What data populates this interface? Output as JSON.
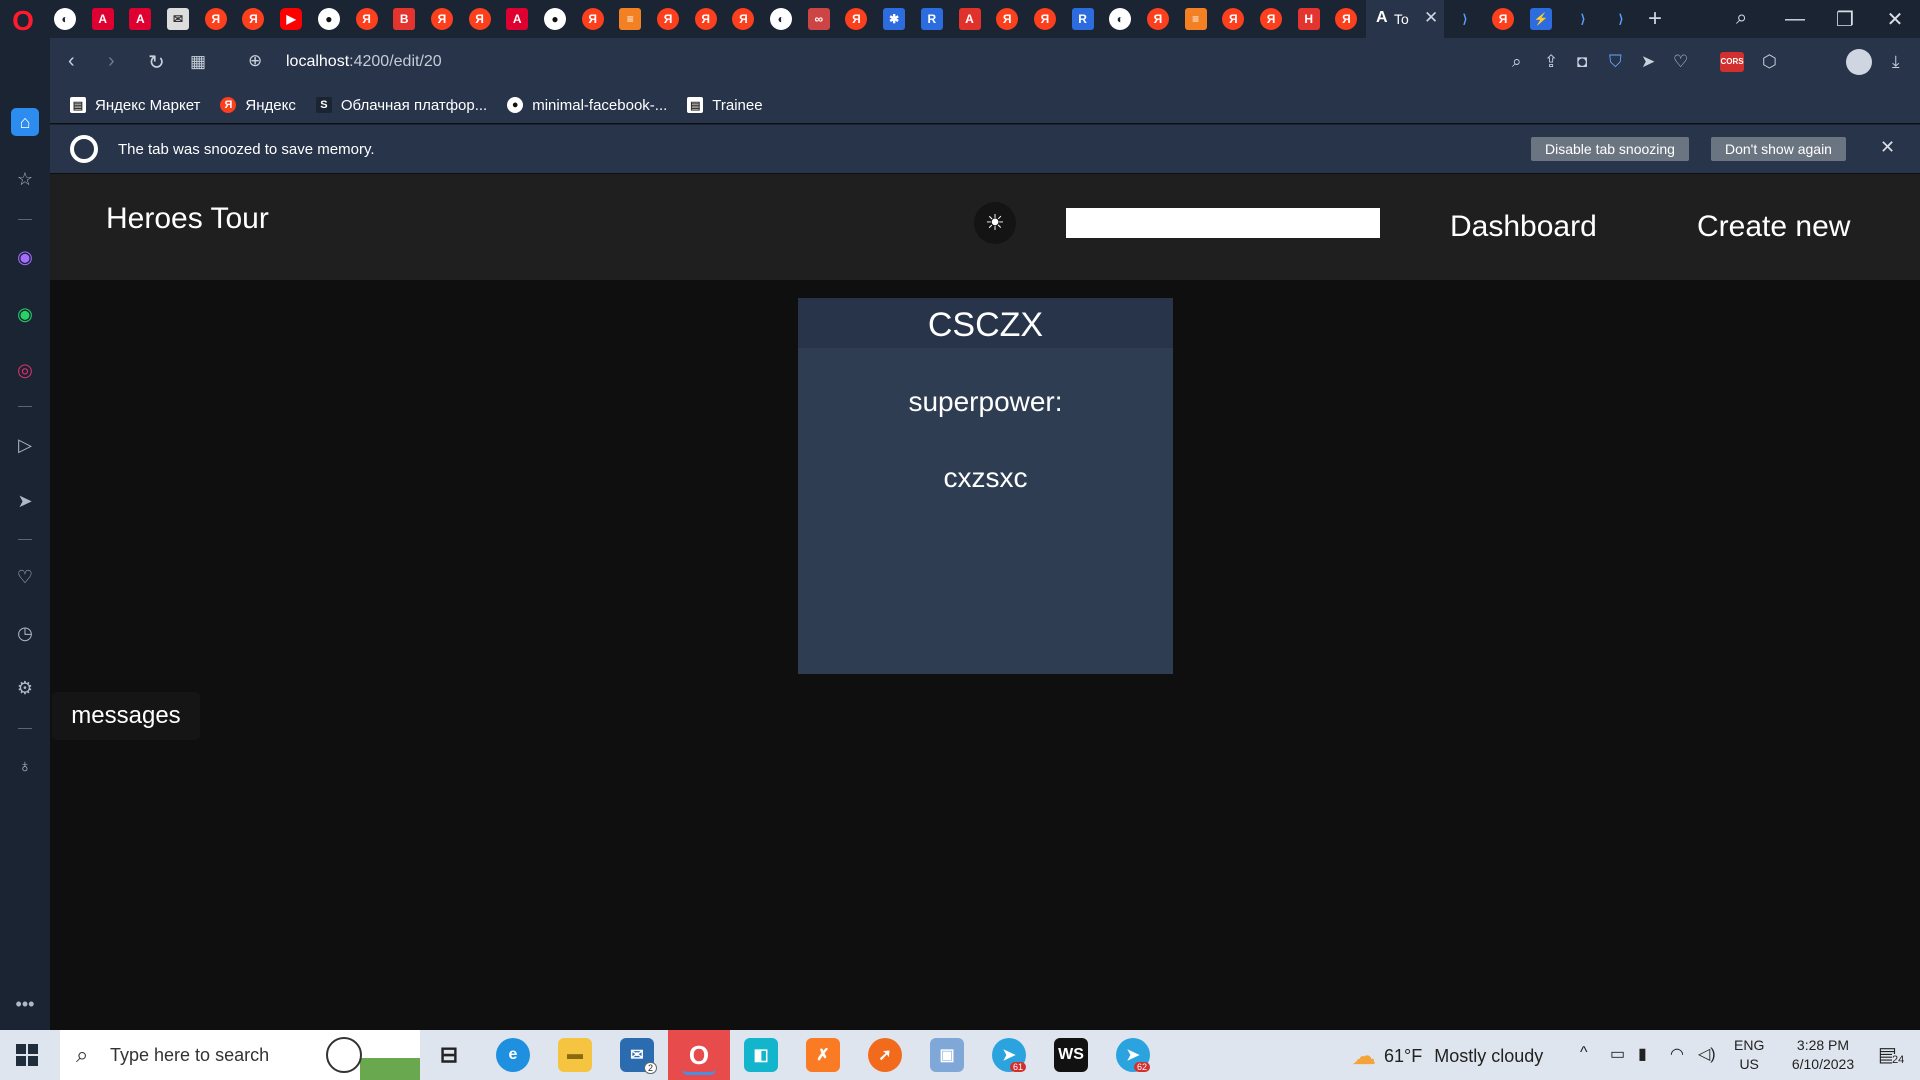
{
  "browser": {
    "active_tab_title": "To",
    "url_host": "localhost",
    "url_path": ":4200/edit/20",
    "bookmarks": [
      {
        "label": "Яндекс Маркет",
        "icon": "document-icon"
      },
      {
        "label": "Яндекс",
        "icon": "yandex-icon"
      },
      {
        "label": "Облачная платфор...",
        "icon": "s-icon"
      },
      {
        "label": "minimal-facebook-...",
        "icon": "github-icon"
      },
      {
        "label": "Trainee",
        "icon": "document-icon"
      }
    ],
    "snooze": {
      "message": "The tab was snoozed to save memory.",
      "disable_label": "Disable tab snoozing",
      "dont_show_label": "Don't show again"
    },
    "cors_label": "CORS"
  },
  "app": {
    "title": "Heroes Tour",
    "search_value": "",
    "nav": {
      "dashboard": "Dashboard",
      "create": "Create new"
    },
    "hero": {
      "name": "CSCZX",
      "power_label": "superpower:",
      "power_value": "cxzsxc"
    },
    "tooltip": "messages"
  },
  "taskbar": {
    "search_placeholder": "Type here to search",
    "mail_badge": "2",
    "telegram_badge_1": "61",
    "telegram_badge_2": "62",
    "weather_temp": "61°F",
    "weather_desc": "Mostly cloudy",
    "lang": "ENG",
    "region": "US",
    "time": "3:28 PM",
    "date": "6/10/2023",
    "notifications": "24"
  },
  "colors": {
    "browser_chrome": "#27344a",
    "tab_strip": "#1b2433",
    "page_bg": "#0f0f0f",
    "app_header": "#1f1f1f",
    "card_bg": "#2e3d51",
    "card_head": "#27344a"
  }
}
